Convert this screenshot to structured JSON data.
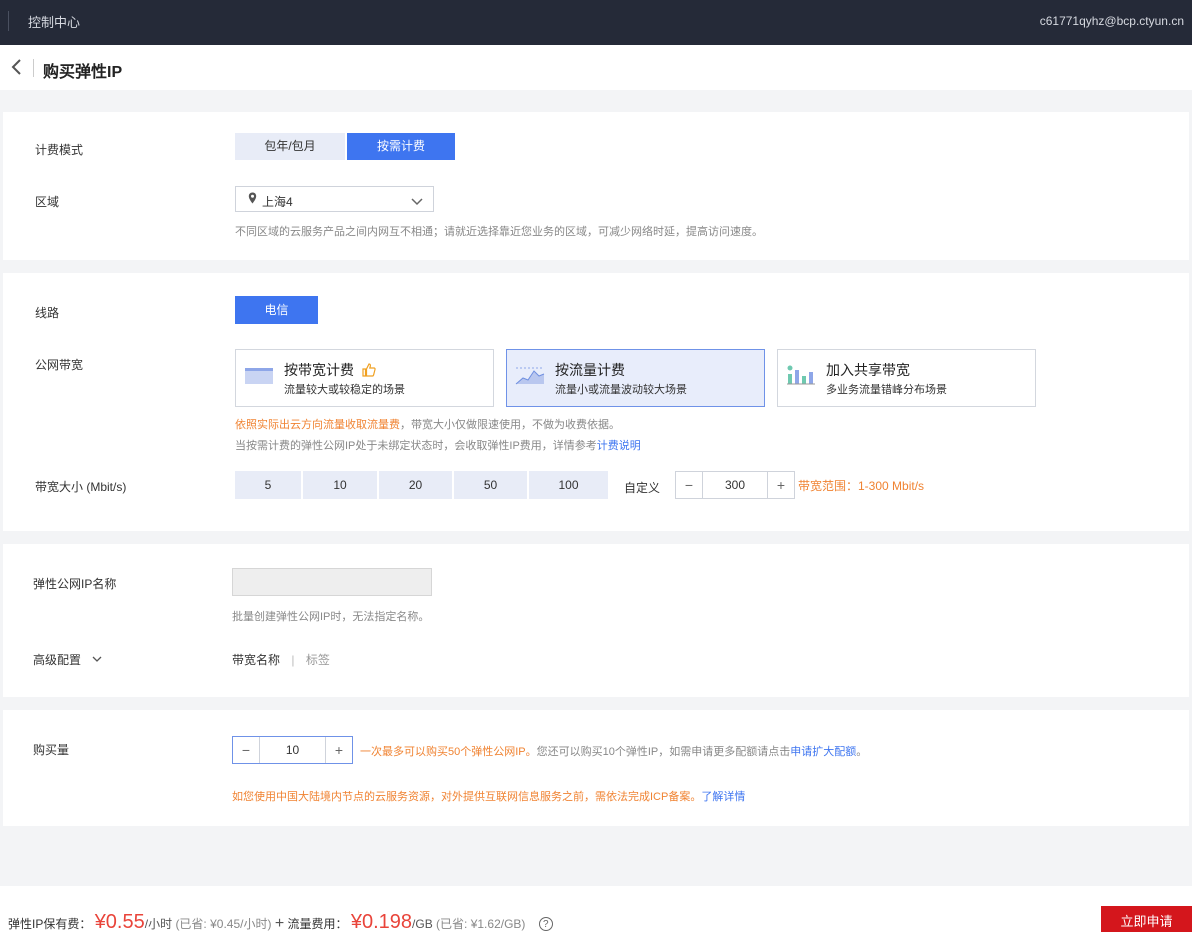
{
  "topbar": {
    "nav": "控制中心",
    "user": "c61771qyhz@bcp.ctyun.cn"
  },
  "header": {
    "title": "购买弹性IP"
  },
  "billing": {
    "label": "计费模式",
    "options": [
      "包年/包月",
      "按需计费"
    ],
    "selected": "按需计费"
  },
  "region": {
    "label": "区域",
    "value": "上海4",
    "hint": "不同区域的云服务产品之间内网互不相通；请就近选择靠近您业务的区域，可减少网络时延，提高访问速度。"
  },
  "line": {
    "label": "线路",
    "option": "电信"
  },
  "bandwidth": {
    "label": "公网带宽",
    "cards": [
      {
        "title": "按带宽计费",
        "desc": "流量较大或较稳定的场景"
      },
      {
        "title": "按流量计费",
        "desc": "流量小或流量波动较大场景"
      },
      {
        "title": "加入共享带宽",
        "desc": "多业务流量错峰分布场景"
      }
    ],
    "selected": "按流量计费",
    "note1_orange": "依照实际出云方向流量收取流量费",
    "note1_rest": "，带宽大小仅做限速使用，不做为收费依据。",
    "note2": "当按需计费的弹性公网IP处于未绑定状态时，会收取弹性IP费用，详情参考",
    "note2_link": "计费说明"
  },
  "bw_size": {
    "label": "带宽大小 (Mbit/s)",
    "options": [
      "5",
      "10",
      "20",
      "50",
      "100"
    ],
    "custom_label": "自定义",
    "value": "300",
    "range": "带宽范围：1-300 Mbit/s"
  },
  "eip_name": {
    "label": "弹性公网IP名称",
    "value": "",
    "hint": "批量创建弹性公网IP时，无法指定名称。"
  },
  "advanced": {
    "label": "高级配置",
    "links": [
      "带宽名称",
      "标签"
    ],
    "separator": "|"
  },
  "quantity": {
    "label": "购买量",
    "value": "10",
    "note_orange": "一次最多可以购买50个弹性公网IP。",
    "note_mid": "您还可以购买10个弹性IP，如需申请更多配额请点击",
    "note_link": "申请扩大配额",
    "note_end": "。",
    "icp": "如您使用中国大陆境内节点的云服务资源，对外提供互联网信息服务之前，需依法完成ICP备案。",
    "icp_link": "了解详情"
  },
  "footer": {
    "eip_label": "弹性IP保有费：",
    "eip_price": "¥0.55",
    "eip_unit": "/小时",
    "eip_saved": "(已省: ¥0.45/小时)",
    "plus": "+",
    "flow_label": "流量费用：",
    "flow_price": "¥0.198",
    "flow_unit": "/GB",
    "flow_saved": "(已省: ¥1.62/GB)",
    "help": "?",
    "submit": "立即申请"
  },
  "colors": {
    "primary": "#3e75f0",
    "accent_orange": "#f08332",
    "price_red": "#e9443a",
    "submit_red": "#d4161c",
    "topbar": "#252a38"
  }
}
